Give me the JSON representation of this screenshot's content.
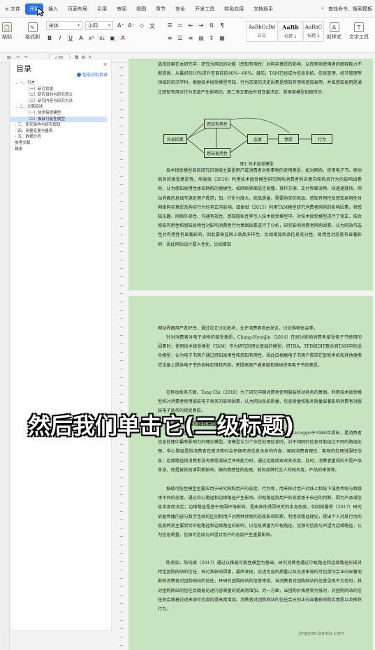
{
  "menubar": {
    "file": "文件",
    "items": [
      "开始",
      "插入",
      "页面布局",
      "引用",
      "审阅",
      "视图",
      "章节",
      "安全",
      "开发工具",
      "特色应用",
      "文档助手"
    ],
    "active_index": 0,
    "search_hint": "查找命令、搜索模板"
  },
  "toolbar": {
    "paste": "粘贴",
    "format_painter": "格式刷",
    "font_name": "宋体",
    "font_size": "小四",
    "styles": [
      {
        "sample": "AaBbCcDd",
        "name": "正文"
      },
      {
        "sample": "AaBb",
        "name": "标题 1"
      },
      {
        "sample": "AaBbC",
        "name": "标题 2"
      }
    ],
    "new_style": "新样式",
    "text_tools": "文字工具",
    "find": "查找"
  },
  "strip": {
    "font_size_2": "小四"
  },
  "navpane": {
    "title": "目录",
    "smart_toc": "智能识别目录",
    "entries": [
      {
        "text": "一、引言",
        "level": 1,
        "caret": true
      },
      {
        "text": "（一）研究背景",
        "level": 2
      },
      {
        "text": "（二）研究目的与研究意义",
        "level": 2
      },
      {
        "text": "（三）研究内容与研究方法",
        "level": 2
      },
      {
        "text": "二、文献综述",
        "level": 1,
        "caret": true
      },
      {
        "text": "（一）技术接受模型",
        "level": 2
      },
      {
        "text": "（二）推敲可能性模型",
        "level": 2,
        "selected": true
      },
      {
        "text": "三、研究架构与研究假设",
        "level": 1,
        "caret": true
      },
      {
        "text": "四、测量变量与量表",
        "level": 1,
        "caret": true
      },
      {
        "text": "五、数据分析",
        "level": 1,
        "caret": true
      },
      {
        "text": "参考文献",
        "level": 0
      },
      {
        "text": "致谢",
        "level": 0
      }
    ]
  },
  "page1": {
    "para_top": "选择效果在本研究中，研究为网站的功能（感知有用性）对购买意愿的影响，从而预测使用者的解释能力不断提高，从最初的10%提升至目前的40%—60%。目前，TAM已经成为信息系统、信息管理、经济管理等领域的前沿学科，根据技术接受模型可知，行为态度的决定因素是感知有用和感知易用，并且感知易用是通过感知有用对行为态度产生影响的，而二者又都由外部变量决定，其框架模型如图所示：",
    "diagram": {
      "external": "外部因素",
      "useful": "感知有用性",
      "easy": "感知易用性",
      "attitude": "态度",
      "intention": "意愿",
      "behavior": "行为"
    },
    "figure_caption": "图1 技术接受模型",
    "para_bottom": "技术接受模型目前研究的领域主要是用户或消费者对新事物的使用意愿，如对网购、使用电子书、移动商务的接受意愿等。熊高强（2016）利用技术接受模型研究网购消费者购买意向和购买行为的影响因素时，认为感知易用性体现网购的便捷性，如网络界面语言易懂、操作方便、支付界面流畅、快递速度快、网站界面信息填写满足用户需求；加：打折力度大、商品质量、需要购买的商品。感知有用性及感知易用性对网络购买意愿及购买行为均有正向影响。田振世（2015）利用TAM模型研究消费者网购的影响因素，将感知乐趣、网络外部性、沟通有效性、感知隐私性等引入技术接受模型中，对技术接受模型进行了修正，结合感知有用性和感知易用性对影响消费者行为意图因素进行了分析，研究影响消费者网购因素。认为网站可选性对有用性有显著影响，因此要保证网上商品多样性，比如增加商品信息充分性。易用性对态度有显著影响：因此网站设计要人性化，比如增加"
  },
  "page2": {
    "para1": "网站界面用户友好性，通过设立讨论板块，允许消费者自由发言，讨论购物体会等。",
    "para2": "针对消费者对电子读物的接受意愿，Chang-HyunJin（2014）在探讨影响消费者接受电子书使用的因素时，使用技术接受模型（TAM）作为研究的理论基础的模型，将TRA、TPB和DIT整合到TAM中的适合模型，认为电子书用户通过感知易用性和感知有用性，因此应根据电子书用户需求在智能手机和其他便携式设备上提供电子书的各种应用和内容，来提高用户满意度和继续使用电子书的意愿。",
    "para3": "在移动商务方面，Tong Chi（2018）为了研究中国消费者使用服装移动商务的意图，利用技术接受模型探讨消费者使用服装电子商务的影响因素，认为网站系统质量、信息质量和服务质量显著影响消费者对服装电子商务的接受意愿。",
    "heading": "（二）推敲可能性模型",
    "para4": "推敲可能性模型（Elaboration Likelihood Model）由Petty和Cacioppo于1986年提出，是消费者信息处理中最有影响力的理论模型。该模型认为个体在处理信息时，对于相同的信息可能经过不同的路径处理，中心路径是指消费者在做决策时会仔细考虑信息本身的内容，强调消费者理性、客观的处理说服性信息；边缘路径指消费者没有意愿或缺乏评估能力时，通过边缘线索改变态度。此时，消费者重视的不是产品本身，而是被其他诸因素影响，偏向情感性的处理，例如品牌代言人的知名度，产品的来源等。",
    "para5": "推敲可能性模型主要应用于研究网购用户的态度、行为等，用来探讨用户对线上和线下或者传统与新媒体不同的态度，通过中心路径和边缘路径产生影响。中枢路径指用户的态度基于自己的判断，因为产品或信息本身而决定；边缘路径是基于周围环境影响，是由其他诱因改变的本身态度。如刘婉馨等（2017）研究依据传播内容与数字连续的区别和用户对两种读物的态度影响因素，利用双路径理论，提出个人对某行为的态度转变主要受到中枢路径和边缘路径的影响，以信息质量为中枢路径，信源可信度与声望为边缘路径，认为信息质量，信源可信度与声望对用户的态度产生重要影响。",
    "para6": "陈美如，陈纯德（2017）通过以推敲可能性模型为基础，研究消费者通过中枢路径和边缘路径形成对特定团购网站的信任，探讨其影响因素。最终发现，论述内容的质量以及论述来源的可信度均会正向显著地影响消费者对团购网站的信任，并研究团购网站的信誉等级，当消费者对团购网站的信誉呈现不为信时，其对团购网站的信任会随着论述内容质量的提高而增加。另一方面，当团购价格感受为低时，对团购网站的信任则会随着论述来源可信度的提高而增加。消费者对团购网站的信任会分别正向显著影响购买意愿以及推荐行为。"
  },
  "caption": "然后我们单击它(二级标题)",
  "watermark": "jingyan.baidu.com"
}
